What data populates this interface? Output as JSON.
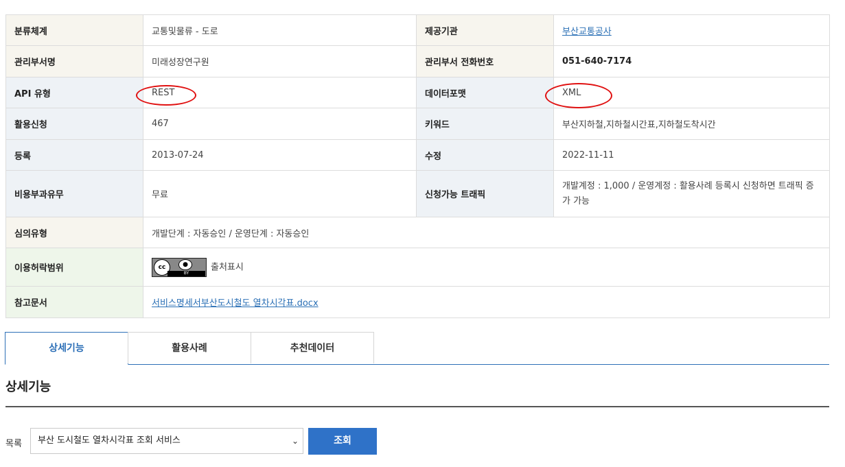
{
  "info": {
    "rows": [
      {
        "label1": "분류체계",
        "value1": "교통및물류 - 도로",
        "label2": "제공기관",
        "value2": "부산교통공사"
      },
      {
        "label1": "관리부서명",
        "value1": "미래성장연구원",
        "label2": "관리부서 전화번호",
        "value2": "051-640-7174"
      },
      {
        "label1": "API 유형",
        "value1": "REST",
        "label2": "데이터포맷",
        "value2": "XML"
      },
      {
        "label1": "활용신청",
        "value1": "467",
        "label2": "키워드",
        "value2": "부산지하철,지하철시간표,지하철도착시간"
      },
      {
        "label1": "등록",
        "value1": "2013-07-24",
        "label2": "수정",
        "value2": "2022-11-11"
      },
      {
        "label1": "비용부과유무",
        "value1": "무료",
        "label2": "신청가능 트래픽",
        "value2": "개발계정 : 1,000 / 운영계정 : 활용사례 등록시 신청하면 트래픽 증가 가능"
      },
      {
        "label1": "심의유형",
        "value1": "개발단계 : 자동승인 / 운영단계 : 자동승인"
      },
      {
        "label1": "이용허락범위",
        "value1": "출처표시",
        "badge_text": "BY",
        "badge_icon": "creative-commons-by"
      },
      {
        "label1": "참고문서",
        "value1": "서비스명세서부산도시철도 열차시각표.docx"
      }
    ]
  },
  "tabs": [
    {
      "label": "상세기능",
      "active": true
    },
    {
      "label": "활용사례",
      "active": false
    },
    {
      "label": "추천데이터",
      "active": false
    }
  ],
  "section": {
    "title": "상세기능"
  },
  "list": {
    "label": "목록",
    "selected": "부산 도시철도 열차시각표 조회 서비스",
    "button": "조회"
  },
  "colors": {
    "accent": "#2f72c8",
    "link": "#2a6fb5",
    "annotation": "#e01010"
  }
}
